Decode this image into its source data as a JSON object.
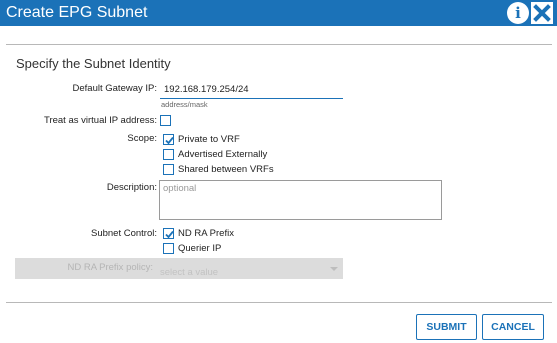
{
  "dialog": {
    "title": "Create EPG Subnet",
    "info_icon": "i"
  },
  "section_title": "Specify the Subnet Identity",
  "gateway": {
    "label": "Default Gateway IP:",
    "value": "192.168.179.254/24",
    "hint": "address/mask"
  },
  "virtual_ip": {
    "label": "Treat as virtual IP address:",
    "checked": false
  },
  "scope": {
    "label": "Scope:",
    "options": [
      {
        "label": "Private to VRF",
        "checked": true
      },
      {
        "label": "Advertised Externally",
        "checked": false
      },
      {
        "label": "Shared between VRFs",
        "checked": false
      }
    ]
  },
  "description": {
    "label": "Description:",
    "placeholder": "optional"
  },
  "subnet_control": {
    "label": "Subnet Control:",
    "options": [
      {
        "label": "ND RA Prefix",
        "checked": true
      },
      {
        "label": "Querier IP",
        "checked": false
      }
    ]
  },
  "nd_ra_policy": {
    "label": "ND RA Prefix policy:",
    "placeholder": "select a value"
  },
  "buttons": {
    "submit": "SUBMIT",
    "cancel": "CANCEL"
  },
  "colors": {
    "accent": "#1b72b8",
    "titlebar": "#1b72b8"
  },
  "icons": {
    "info": "info-icon",
    "close": "close-icon",
    "check": "checkmark-icon",
    "dropdown": "chevron-down-icon"
  }
}
